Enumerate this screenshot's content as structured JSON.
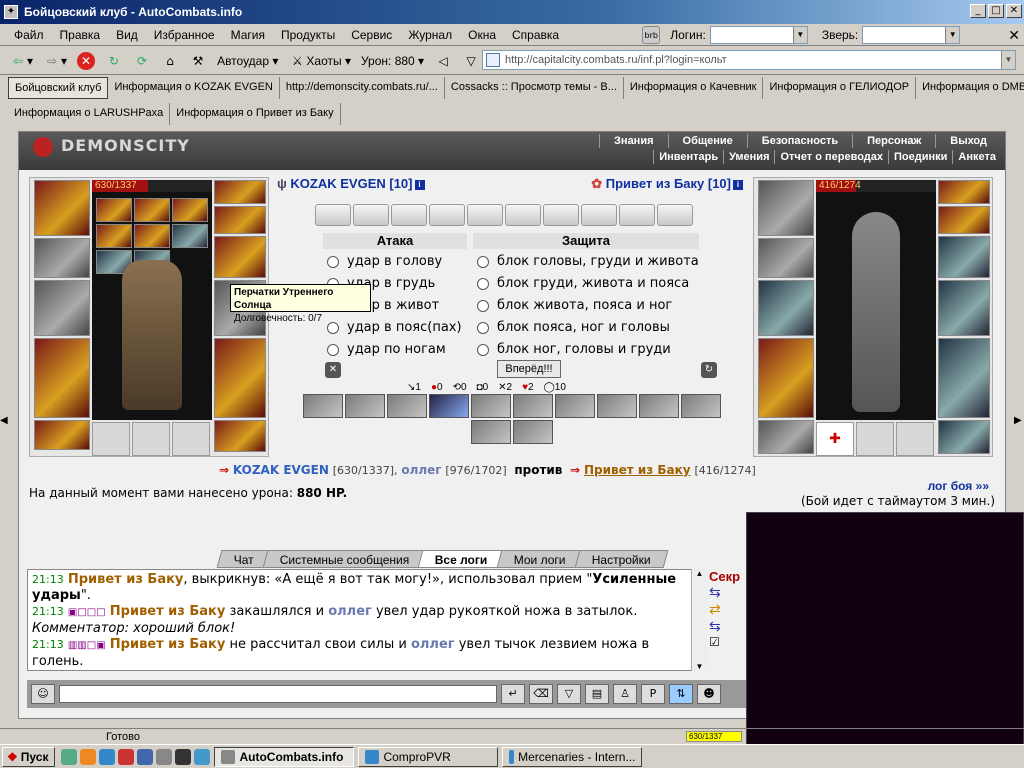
{
  "window": {
    "title": "Бойцовский клуб - AutoCombats.info"
  },
  "menu": {
    "items": [
      "Файл",
      "Правка",
      "Вид",
      "Избранное",
      "Магия",
      "Продукты",
      "Сервис",
      "Журнал",
      "Окна",
      "Справка"
    ],
    "login_label": "Логин:",
    "pet_label": "Зверь:"
  },
  "toolbar": {
    "autoudar": "Автоудар",
    "haoty": "Хаоты",
    "uron": "Урон: 880",
    "address": "http://capitalcity.combats.ru/inf.pl?login=кольт"
  },
  "tabs_row1": [
    "Бойцовский клуб",
    "Информация о KOZAK EVGEN",
    "http://demonscity.combats.ru/...",
    "Cossacks :: Просмотр темы - В...",
    "Информация о Качевник",
    "Информация о ГЕЛИОДОР",
    "Информация о DMB"
  ],
  "tabs_row2": [
    "Информация о LARUSHPaxa",
    "Информация о Привет из Баку"
  ],
  "game": {
    "logo": "DEMONSCITY",
    "topnav": [
      "Знания",
      "Общение",
      "Безопасность",
      "Персонаж",
      "Выход"
    ],
    "subnav": [
      "Инвентарь",
      "Умения",
      "Отчет о переводах",
      "Поединки",
      "Анкета"
    ],
    "left_hp": "630/1337",
    "right_hp": "416/1274",
    "player1": "KOZAK EVGEN [10]",
    "player2": "Привет из Баку [10]",
    "tooltip_title": "Перчатки Утреннего Солнца",
    "tooltip_body": "Долговечность: 0/7",
    "attack_head": "Атака",
    "defense_head": "Защита",
    "attacks": [
      "удар в голову",
      "удар в грудь",
      "удар в живот",
      "удар в пояс(пах)",
      "удар по ногам"
    ],
    "defenses": [
      "блок головы, груди и живота",
      "блок груди, живота и пояса",
      "блок живота, пояса и ног",
      "блок пояса, ног и головы",
      "блок ног, головы и груди"
    ],
    "go": "Вперёд!!!",
    "stats": [
      "1",
      "0",
      "0",
      "0",
      "2",
      "2",
      "10"
    ],
    "vs_p1": "KOZAK EVGEN",
    "vs_p1_hp": "[630/1337],",
    "vs_p2": "оллег",
    "vs_p2_hp": "[976/1702]",
    "vs_word": "против",
    "vs_p3": "Привет из Баку",
    "vs_p3_hp": "[416/1274]",
    "damage_text": "На данный момент вами нанесено урона:",
    "damage_value": "880 HP.",
    "log_link": "лог боя »»",
    "timeout": "(Бой идет с таймаутом 3 мин.)"
  },
  "chat": {
    "tabs": [
      "Чат",
      "Системные сообщения",
      "Все логи",
      "Мои логи",
      "Настройки"
    ],
    "active_tab": "Все логи",
    "line1_time": "21:13",
    "line1_name": "Привет из Баку",
    "line1_text": ", выкрикнув: «А ещё я вот так могу!», использовал прием \"",
    "line1_bold": "Усиленные удары",
    "line1_end": "\".",
    "line2_time": "21:13",
    "line2_name": "Привет из Баку",
    "line2_text": " закашлялся и ",
    "line2_name2": "оллег",
    "line2_text2": " увел удар рукояткой ножа в затылок.",
    "line3": "Комментатор: хороший блок!",
    "line4_time": "21:13",
    "line4_name": "Привет из Баку",
    "line4_text": " не рассчитал свои силы и ",
    "line4_name2": "оллег",
    "line4_text2": " увел тычок лезвием ножа в голень.",
    "side_label": "Секр"
  },
  "status": {
    "text": "Готово",
    "mini_hp": "630/1337"
  },
  "taskbar": {
    "start": "Пуск",
    "tasks": [
      "AutoCombats.info",
      "ComproPVR",
      "Mercenaries - Intern..."
    ]
  }
}
